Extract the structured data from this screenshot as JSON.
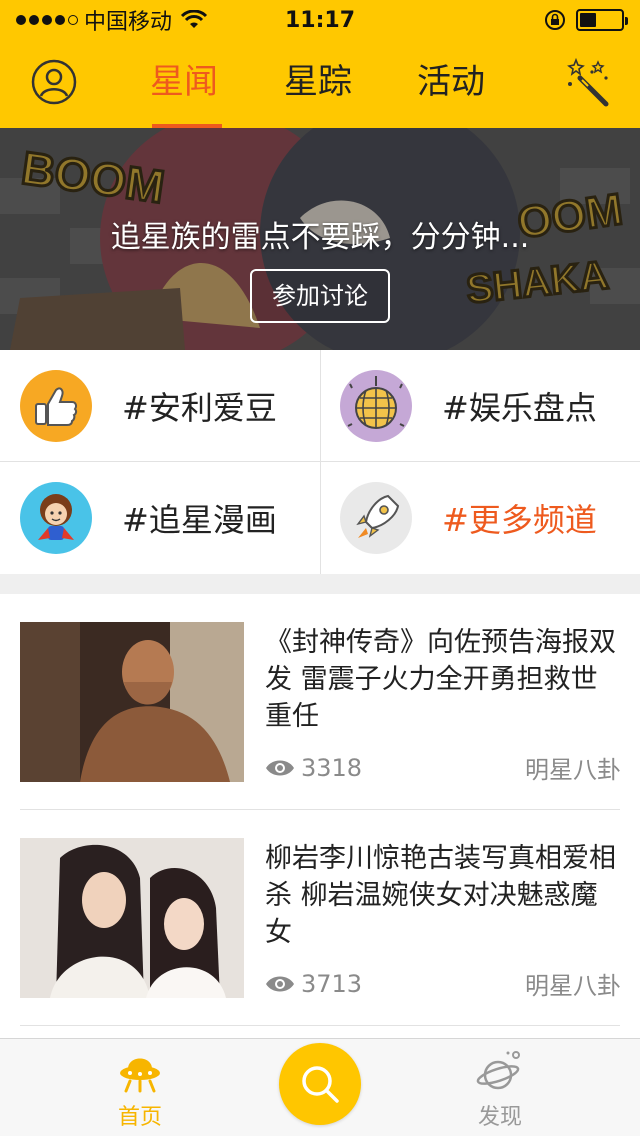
{
  "status_bar": {
    "carrier": "中国移动",
    "time": "11:17"
  },
  "nav": {
    "tabs": [
      {
        "label": "星闻",
        "active": true
      },
      {
        "label": "星踪",
        "active": false
      },
      {
        "label": "活动",
        "active": false
      }
    ],
    "avatar_icon": "user-avatar-icon",
    "right_icon": "magic-wand-icon"
  },
  "banner": {
    "title": "追星族的雷点不要踩，分分钟...",
    "button_label": "参加讨论",
    "art_text_left": "BOOM",
    "art_text_right_top": "OOM",
    "art_text_right_bottom": "SHAKA"
  },
  "channels": [
    {
      "label": "#安利爱豆",
      "icon": "thumbs-up-icon"
    },
    {
      "label": "#娱乐盘点",
      "icon": "disco-ball-icon"
    },
    {
      "label": "#追星漫画",
      "icon": "cartoon-hero-icon"
    },
    {
      "label": "#更多频道",
      "icon": "rocket-icon",
      "highlight": true
    }
  ],
  "news": [
    {
      "title": "《封神传奇》向佐预告海报双发  雷震子火力全开勇担救世重任",
      "views": "3318",
      "category": "明星八卦"
    },
    {
      "title": "柳岩李川惊艳古装写真相爱相杀   柳岩温婉侠女对决魅惑魔女",
      "views": "3713",
      "category": "明星八卦"
    }
  ],
  "tab_bar": {
    "home_label": "首页",
    "discover_label": "发现",
    "search_icon": "search-icon"
  },
  "colors": {
    "brand_yellow": "#ffc800",
    "accent_orange": "#ee5a1e",
    "muted_gray": "#8a8a8a"
  }
}
